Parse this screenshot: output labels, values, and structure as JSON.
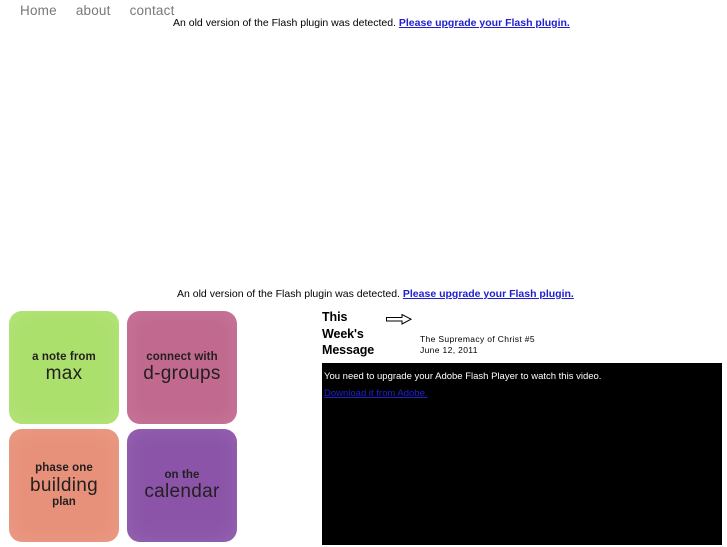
{
  "nav": {
    "items": [
      {
        "label": "Home"
      },
      {
        "label": "about"
      },
      {
        "label": "contact"
      }
    ]
  },
  "flash_warnings": {
    "top": {
      "message": "An old version of the Flash plugin was detected.",
      "link_label": "Please upgrade your Flash plugin."
    },
    "middle": {
      "message": "An old version of the Flash plugin was detected.",
      "link_label": "Please upgrade your Flash plugin."
    }
  },
  "tiles": [
    {
      "line1": "a note from",
      "line2": "max",
      "line3": "",
      "color": "#ace06d",
      "name": "tile-note-from-max"
    },
    {
      "line1": "connect with",
      "line2": "d-groups",
      "line3": "",
      "color": "#c1698f",
      "name": "tile-connect-with-d-groups"
    },
    {
      "line1": "phase one",
      "line2": "building",
      "line3": "plan",
      "color": "#e8917a",
      "name": "tile-phase-one-building-plan"
    },
    {
      "line1": "on the",
      "line2": "calendar",
      "line3": "",
      "color": "#8b54a8",
      "name": "tile-on-the-calendar"
    }
  ],
  "message_panel": {
    "title": "This Week's Message",
    "arrow_icon": "arrow-right-icon",
    "sermon_title": "The Supremacy of Christ #5",
    "sermon_date": "June 12, 2011"
  },
  "video": {
    "upgrade_text": "You need to upgrade your Adobe Flash Player to watch this video.",
    "download_link": "Download it from Adobe.",
    "background_color": "#000000"
  },
  "colors": {
    "link_blue": "#2020d0",
    "nav_gray": "#77797a",
    "tile_text": "#231f20"
  }
}
